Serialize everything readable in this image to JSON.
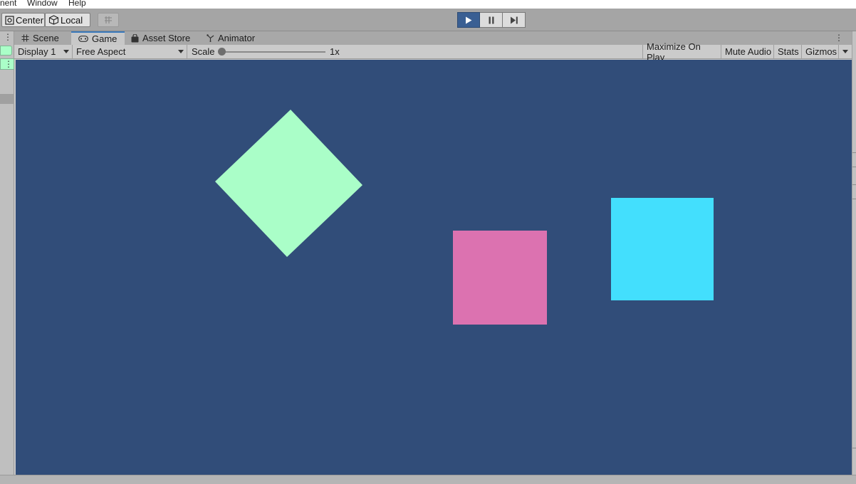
{
  "menu": {
    "items": [
      "nent",
      "Window",
      "Help"
    ]
  },
  "toolbar": {
    "pivot_label": "Center",
    "space_label": "Local",
    "play_icon": "play-icon",
    "pause_icon": "pause-icon",
    "step_icon": "step-icon",
    "accent": "#3a5f93"
  },
  "tabs": [
    {
      "label": "Scene",
      "icon": "scene-grid-icon"
    },
    {
      "label": "Game",
      "icon": "gamepad-icon",
      "active": true
    },
    {
      "label": "Asset Store",
      "icon": "bag-icon"
    },
    {
      "label": "Animator",
      "icon": "animator-icon"
    }
  ],
  "game_toolbar": {
    "display": "Display 1",
    "aspect": "Free Aspect",
    "scale_label": "Scale",
    "scale_value": "1x",
    "scale_level": 0.0,
    "maximize": "Maximize On Play",
    "mute": "Mute Audio",
    "stats": "Stats",
    "gizmos": "Gizmos"
  },
  "viewport": {
    "background": "#314d79",
    "shapes": [
      {
        "kind": "diamond",
        "color": "#aafec8"
      },
      {
        "kind": "square",
        "color": "#dc72b0"
      },
      {
        "kind": "square",
        "color": "#43dffd"
      }
    ]
  }
}
